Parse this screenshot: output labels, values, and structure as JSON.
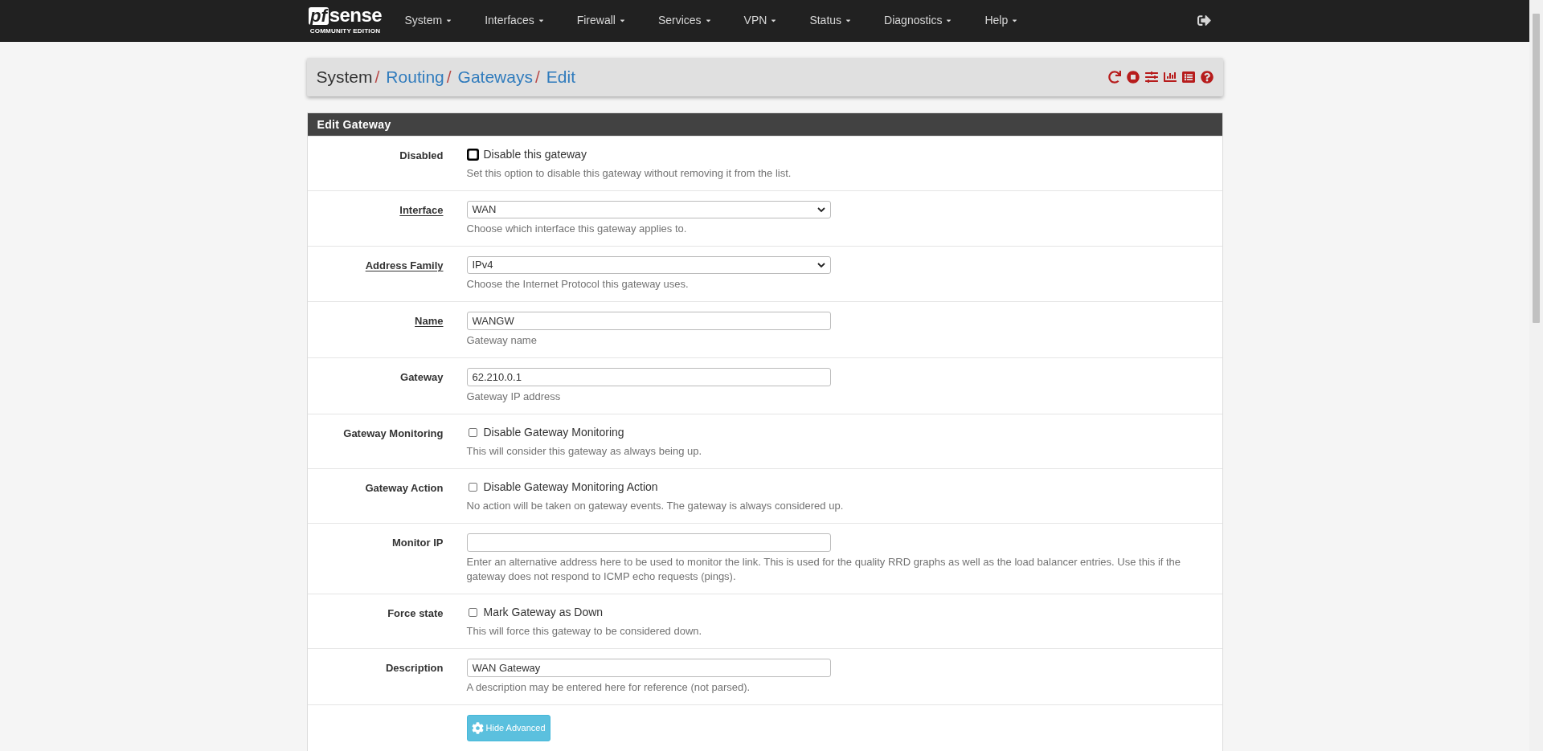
{
  "brand": {
    "mark": "pf",
    "word": "sense",
    "edition": "COMMUNITY EDITION"
  },
  "nav": [
    {
      "label": "System"
    },
    {
      "label": "Interfaces"
    },
    {
      "label": "Firewall"
    },
    {
      "label": "Services"
    },
    {
      "label": "VPN"
    },
    {
      "label": "Status"
    },
    {
      "label": "Diagnostics"
    },
    {
      "label": "Help"
    }
  ],
  "breadcrumb": [
    {
      "label": "System",
      "link": false,
      "separator": "/"
    },
    {
      "label": "Routing",
      "link": true,
      "separator": "/"
    },
    {
      "label": "Gateways",
      "link": true,
      "separator": "/"
    },
    {
      "label": "Edit",
      "link": true
    }
  ],
  "panel": {
    "title": "Edit Gateway"
  },
  "rows": [
    {
      "kind": "checkbox",
      "label": "Disabled",
      "required": false,
      "option": "Disable this gateway",
      "checked": false,
      "focused": true,
      "help": "Set this option to disable this gateway without removing it from the list."
    },
    {
      "kind": "select",
      "label": "Interface",
      "required": true,
      "value": "WAN",
      "help": "Choose which interface this gateway applies to."
    },
    {
      "kind": "select",
      "label": "Address Family",
      "required": true,
      "value": "IPv4",
      "help": "Choose the Internet Protocol this gateway uses."
    },
    {
      "kind": "text",
      "label": "Name",
      "required": true,
      "value": "WANGW",
      "help": "Gateway name"
    },
    {
      "kind": "text",
      "label": "Gateway",
      "required": false,
      "value": "62.210.0.1",
      "help": "Gateway IP address"
    },
    {
      "kind": "checkbox",
      "label": "Gateway Monitoring",
      "required": false,
      "option": "Disable Gateway Monitoring",
      "checked": false,
      "focused": false,
      "help": "This will consider this gateway as always being up."
    },
    {
      "kind": "checkbox",
      "label": "Gateway Action",
      "required": false,
      "option": "Disable Gateway Monitoring Action",
      "checked": false,
      "focused": false,
      "help": "No action will be taken on gateway events. The gateway is always considered up."
    },
    {
      "kind": "text",
      "label": "Monitor IP",
      "required": false,
      "help": "Enter an alternative address here to be used to monitor the link. This is used for the quality RRD graphs as well as the load balancer entries. Use this if the gateway does not respond to ICMP echo requests (pings)."
    },
    {
      "kind": "checkbox",
      "label": "Force state",
      "required": false,
      "option": "Mark Gateway as Down",
      "checked": false,
      "focused": false,
      "help": "This will force this gateway to be considered down."
    },
    {
      "kind": "text",
      "label": "Description",
      "required": false,
      "value": "WAN Gateway",
      "help": "A description may be entered here for reference (not parsed)."
    },
    {
      "kind": "button",
      "button": "Hide Advanced"
    }
  ]
}
